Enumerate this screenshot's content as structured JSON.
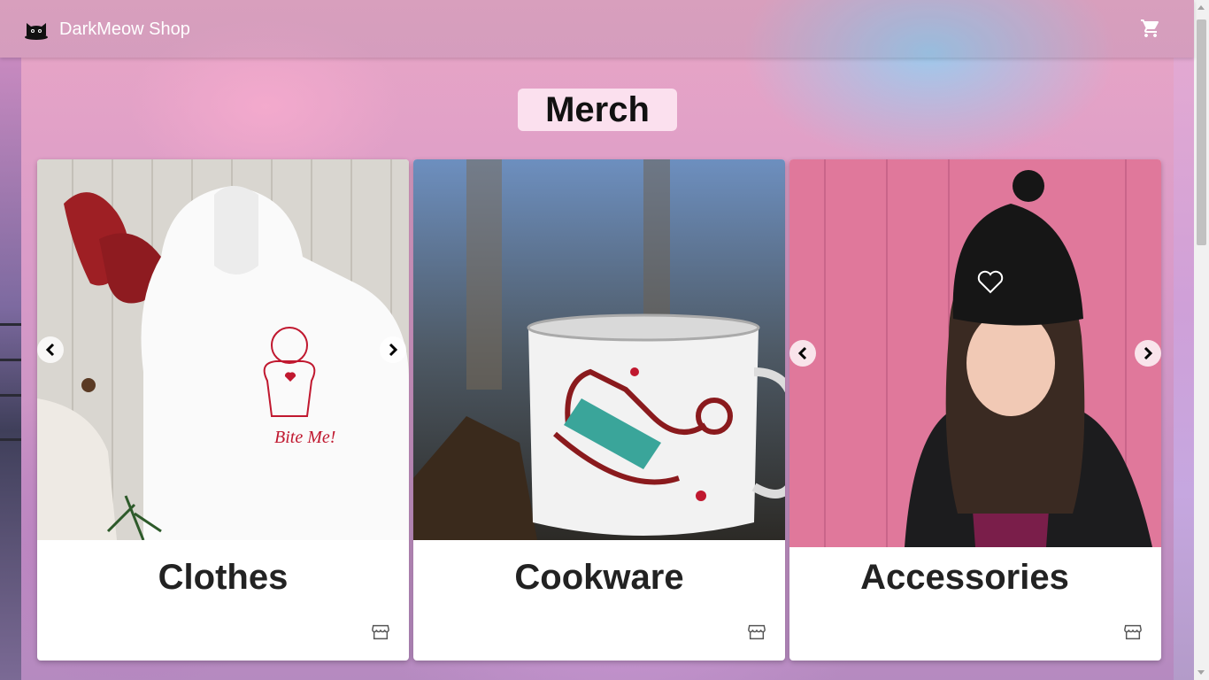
{
  "app": {
    "brand_name": "DarkMeow Shop"
  },
  "header": {
    "cart_icon": "cart-icon",
    "logo_icon": "cat-logo-icon"
  },
  "main": {
    "title": "Merch",
    "categories": [
      {
        "name": "Clothes",
        "image": "white hoodie with gingerbread man print",
        "icon": "store-icon",
        "has_carousel": true
      },
      {
        "name": "Cookware",
        "image": "enamel camping mug with sled print",
        "icon": "store-icon",
        "has_carousel": false
      },
      {
        "name": "Accessories",
        "image": "woman wearing black beanie",
        "icon": "store-icon",
        "has_carousel": true
      }
    ],
    "hoodie_print_text": "Bite Me!"
  },
  "colors": {
    "accent_red": "#c0182f",
    "card_bg": "#ffffff",
    "header_text": "#ffffff"
  }
}
